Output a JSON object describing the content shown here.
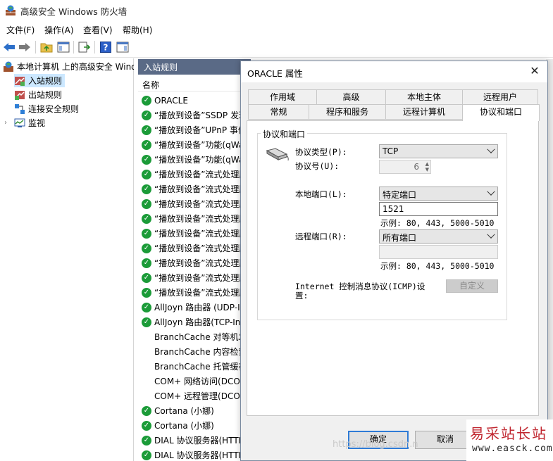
{
  "window": {
    "title": "高级安全 Windows 防火墙"
  },
  "menu": [
    "文件(F)",
    "操作(A)",
    "查看(V)",
    "帮助(H)"
  ],
  "toolbar": {
    "icons": [
      "back-icon",
      "forward-icon",
      "up-folder-icon",
      "show-hide-console-tree-icon",
      "export-list-icon",
      "help-icon",
      "show-action-pane-icon"
    ]
  },
  "tree": {
    "root": "本地计算机 上的高级安全 Windows",
    "items": [
      "入站规则",
      "出站规则",
      "连接安全规则",
      "监视"
    ]
  },
  "rules_pane": {
    "header": "入站规则",
    "column_name": "名称",
    "rows": [
      {
        "name": "ORACLE",
        "enabled": true
      },
      {
        "name": "“播放到设备”SSDP 发现",
        "enabled": true
      },
      {
        "name": "“播放到设备”UPnP 事件",
        "enabled": true
      },
      {
        "name": "“播放到设备”功能(qWave",
        "enabled": true
      },
      {
        "name": "“播放到设备”功能(qWave",
        "enabled": true
      },
      {
        "name": "“播放到设备”流式处理服",
        "enabled": true
      },
      {
        "name": "“播放到设备”流式处理服",
        "enabled": true
      },
      {
        "name": "“播放到设备”流式处理服",
        "enabled": true
      },
      {
        "name": "“播放到设备”流式处理服",
        "enabled": true
      },
      {
        "name": "“播放到设备”流式处理服",
        "enabled": true
      },
      {
        "name": "“播放到设备”流式处理服",
        "enabled": true
      },
      {
        "name": "“播放到设备”流式处理服",
        "enabled": true
      },
      {
        "name": "“播放到设备”流式处理服",
        "enabled": true
      },
      {
        "name": "“播放到设备”流式处理服",
        "enabled": true
      },
      {
        "name": "AllJoyn 路由器 (UDP-In)",
        "enabled": true
      },
      {
        "name": "AllJoyn 路由器(TCP-In)",
        "enabled": true
      },
      {
        "name": "BranchCache 对等机发现",
        "enabled": false
      },
      {
        "name": "BranchCache 内容检索",
        "enabled": false
      },
      {
        "name": "BranchCache 托管缓存",
        "enabled": false
      },
      {
        "name": "COM+ 网络访问(DCOM",
        "enabled": false
      },
      {
        "name": "COM+ 远程管理(DCOM",
        "enabled": false
      },
      {
        "name": "Cortana (小娜)",
        "enabled": true
      },
      {
        "name": "Cortana (小娜)",
        "enabled": true
      },
      {
        "name": "DIAL 协议服务器(HTTP",
        "enabled": true
      },
      {
        "name": "DIAL 协议服务器(HTTP",
        "enabled": true
      }
    ]
  },
  "dialog": {
    "title": "ORACLE 属性",
    "close": "✕",
    "tabs_row1": [
      "作用域",
      "高级",
      "本地主体",
      "远程用户"
    ],
    "tabs_row2": [
      "常规",
      "程序和服务",
      "远程计算机",
      "协议和端口"
    ],
    "active_tab": "协议和端口",
    "group_title": "协议和端口",
    "protocol_type_label": "协议类型(P):",
    "protocol_type_value": "TCP",
    "protocol_number_label": "协议号(U):",
    "protocol_number_value": "6",
    "local_port_label": "本地端口(L):",
    "local_port_value": "特定端口",
    "local_port_text": "1521",
    "example1": "示例: 80, 443, 5000-5010",
    "remote_port_label": "远程端口(R):",
    "remote_port_value": "所有端口",
    "example2": "示例: 80, 443, 5000-5010",
    "icmp_label_line1": "Internet 控制消息协议(ICMP)设",
    "icmp_label_line2": "置:",
    "customize_button": "自定义",
    "ok_button": "确定",
    "cancel_button": "取消"
  },
  "watermark": "https://blog.csdn.n",
  "logo": {
    "big": "易采站长站",
    "url": "www.easck.com"
  }
}
